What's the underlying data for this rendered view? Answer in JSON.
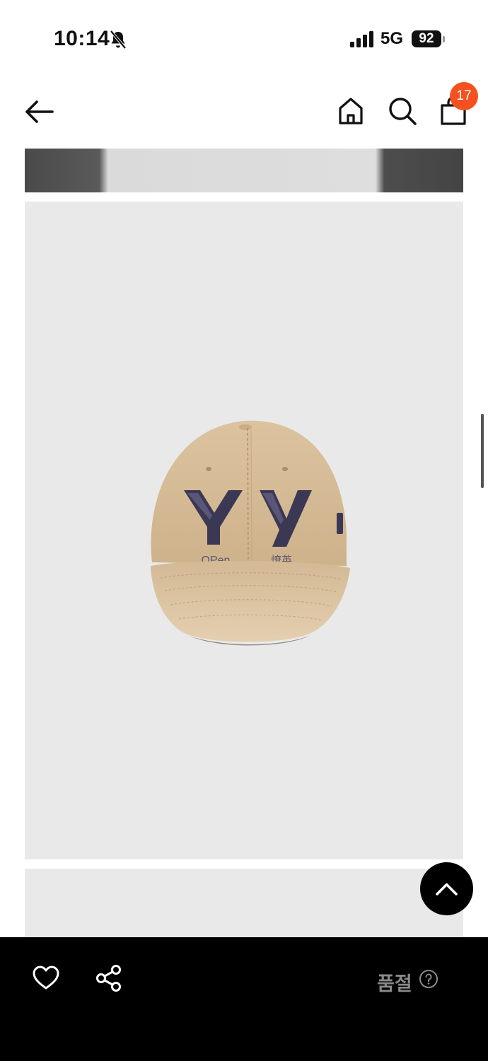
{
  "status_bar": {
    "time": "10:14",
    "network": "5G",
    "battery": "92",
    "icons": [
      "bell-off-icon",
      "signal-icon",
      "battery-icon"
    ]
  },
  "nav": {
    "icons": [
      "back-arrow-icon",
      "home-icon",
      "search-icon",
      "shopping-bag-icon"
    ],
    "cart_count": "17"
  },
  "product": {
    "cap_text_left": "OPen",
    "cap_text_right": "燎英",
    "cap_letters": "Y Y"
  },
  "bottom_bar": {
    "status_label": "품절",
    "icons": [
      "heart-icon",
      "share-icon",
      "help-icon"
    ]
  },
  "colors": {
    "badge": "#f4511e",
    "image_bg": "#e9e9e9",
    "cap_body": "#d6bd98",
    "cap_letters": "#3b3854",
    "bottom_bar": "#000000",
    "status_label": "#8a8a8a"
  }
}
